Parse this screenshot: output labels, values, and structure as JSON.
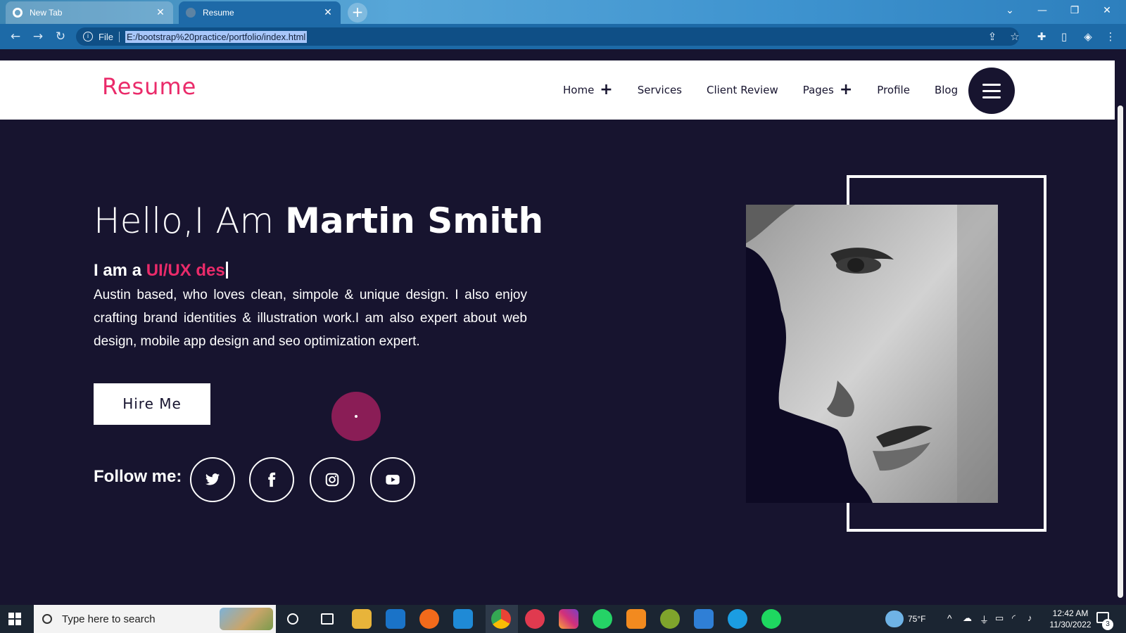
{
  "browser": {
    "tabs": [
      {
        "title": "New Tab",
        "active": false
      },
      {
        "title": "Resume",
        "active": true
      }
    ],
    "address": {
      "scheme_label": "File",
      "url": "E:/bootstrap%20practice/portfolio/index.html"
    }
  },
  "site": {
    "logo": "Resume",
    "nav": [
      {
        "label": "Home",
        "has_submenu": true
      },
      {
        "label": "Services",
        "has_submenu": false
      },
      {
        "label": "Client Review",
        "has_submenu": false
      },
      {
        "label": "Pages",
        "has_submenu": true
      },
      {
        "label": "Profile",
        "has_submenu": false
      },
      {
        "label": "Blog",
        "has_submenu": false
      }
    ],
    "plus_glyph": "+"
  },
  "hero": {
    "greeting": "Hello,I Am",
    "name": "Martin Smith",
    "role_prefix": "I am a",
    "role_typed": "UI/UX des",
    "bio": "Austin based, who loves clean, simpole & unique design. I also enjoy crafting brand identities & illustration work.I am also expert about web design, mobile app design and seo optimization expert.",
    "hire_label": "Hire Me",
    "follow_label": "Follow me:",
    "social": [
      "twitter-icon",
      "facebook-icon",
      "instagram-icon",
      "youtube-icon"
    ]
  },
  "taskbar": {
    "search_placeholder": "Type here to search",
    "weather": "75°F",
    "time": "12:42 AM",
    "date": "11/30/2022",
    "notification_count": "3"
  },
  "colors": {
    "accent": "#ea2b6a",
    "background": "#17142f",
    "header_bg": "#ffffff"
  }
}
